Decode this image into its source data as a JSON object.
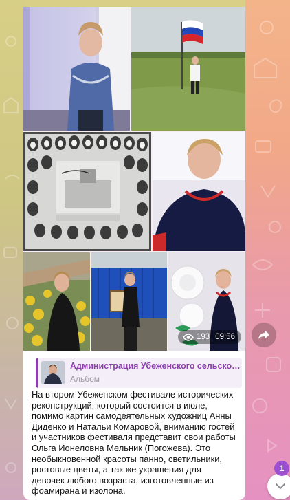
{
  "album": {
    "photos": [
      {
        "name": "woman-indoor-portrait"
      },
      {
        "name": "woman-with-russian-flag"
      },
      {
        "name": "vintage-class-photo-collage"
      },
      {
        "name": "woman-navy-dress-portrait"
      },
      {
        "name": "woman-in-flower-garden"
      },
      {
        "name": "woman-with-painting-by-fence"
      },
      {
        "name": "woman-with-white-paper-flowers"
      }
    ],
    "views": "193",
    "time": "09:56"
  },
  "reply": {
    "title": "Администрация Убеженского сельского по...",
    "subtitle": "Альбом"
  },
  "message": {
    "text": "На  втором Убеженском фестивале исторических\nреконструкций, который состоится в июле,\nпомимо картин самодеятельных художниц Анны\nДиденко и Натальи Комаровой, вниманию гостей\nи участников фестиваля представит свои работы\nОльга Ионеловна  Мельник (Погожева).  Это\nнеобыкновенной красоты панно, светильники,\nростовые цветы,  а так же украшения для\nдевочек любого возраста, изготовленные из\nфоамирана и изолона."
  },
  "unread_badge": "1",
  "colors": {
    "accent": "#8e3fae",
    "badge": "#9c4fd0"
  },
  "icons": [
    "eye-icon",
    "share-icon",
    "chevron-down-icon"
  ]
}
